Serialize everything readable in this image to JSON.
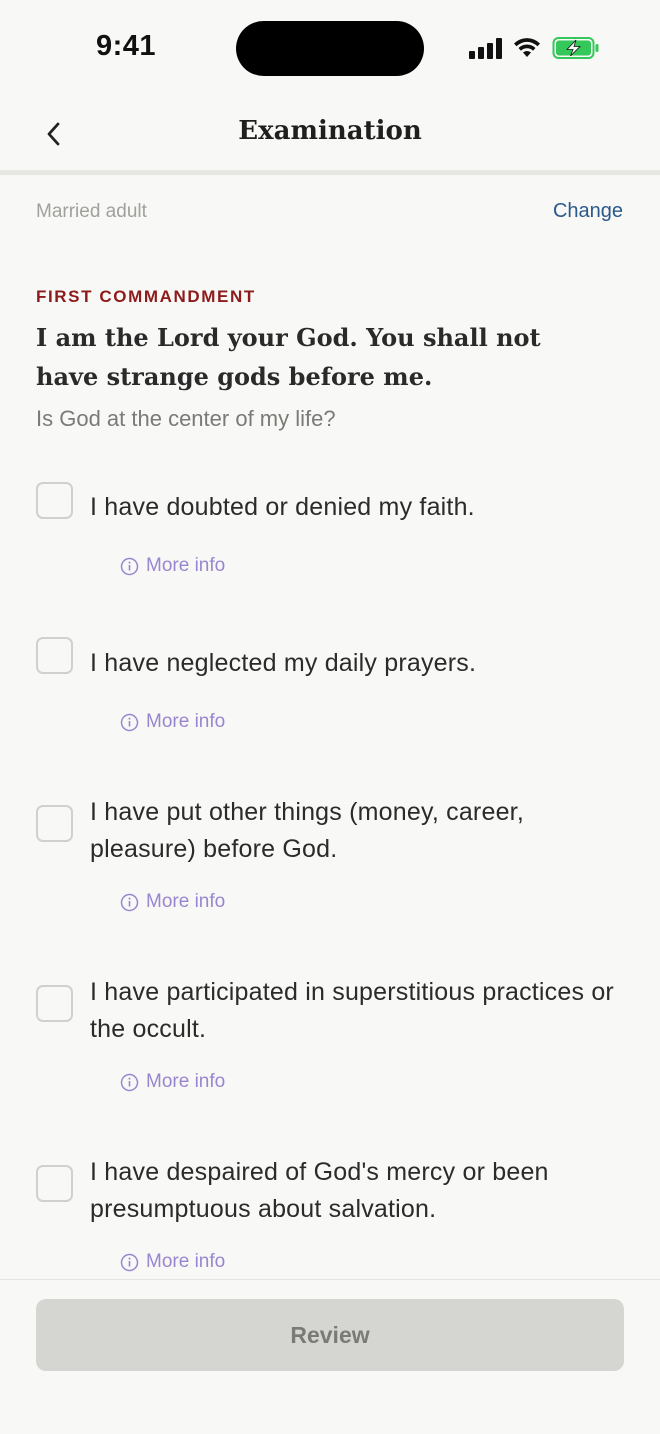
{
  "status_bar": {
    "time": "9:41"
  },
  "nav": {
    "title": "Examination"
  },
  "profile": {
    "label": "Married adult",
    "change_label": "Change"
  },
  "section": {
    "eyebrow": "FIRST COMMANDMENT",
    "title": "I am the Lord your God. You shall not have strange gods before me.",
    "subtitle": "Is God at the center of my life?"
  },
  "questions": [
    {
      "text": "I have doubted or denied my faith.",
      "checked": false,
      "more_info_label": "More info"
    },
    {
      "text": "I have neglected my daily prayers.",
      "checked": false,
      "more_info_label": "More info"
    },
    {
      "text": "I have put other things (money, career, pleasure) before God.",
      "checked": false,
      "more_info_label": "More info"
    },
    {
      "text": "I have participated in superstitious practices or the occult.",
      "checked": false,
      "more_info_label": "More info"
    },
    {
      "text": "I have despaired of God's mercy or been presumptuous about salvation.",
      "checked": false,
      "more_info_label": "More info"
    }
  ],
  "footer": {
    "review_label": "Review"
  },
  "colors": {
    "accent_red": "#8E1B1B",
    "link_blue": "#2B5A8A",
    "more_info_purple": "#9A86D0",
    "battery_green": "#34C759"
  },
  "icons": [
    "signal-icon",
    "wifi-icon",
    "battery-charging-icon",
    "chevron-left-icon",
    "info-icon"
  ]
}
